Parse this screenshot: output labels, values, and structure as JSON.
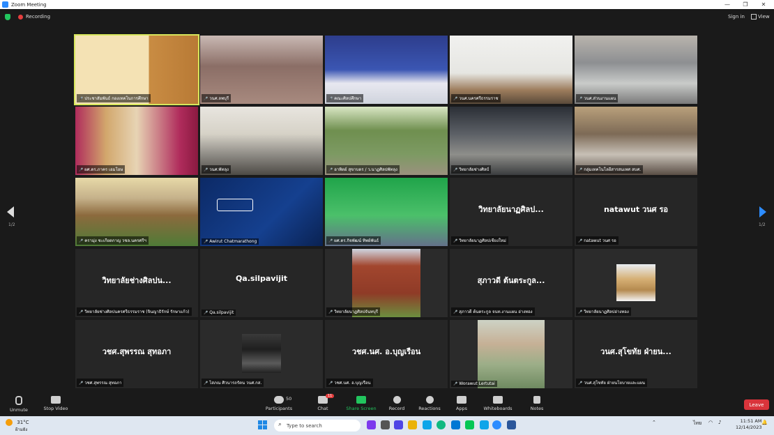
{
  "window": {
    "title": "Zoom Meeting",
    "minimize": "—",
    "restore": "❐",
    "close": "✕"
  },
  "topbar": {
    "recording": "Recording",
    "sign_in": "Sign in",
    "view": "View"
  },
  "tiles": [
    {
      "name": "ประชาสัมพันธ์ กองเทคโนการศึกษา",
      "big": "",
      "active": true,
      "scene": "room-yellow"
    },
    {
      "name": "วนศ.ลพบุรี",
      "big": "",
      "scene": "room-office"
    },
    {
      "name": "คณะศิลปศึกษา",
      "big": "",
      "scene": "room-blue"
    },
    {
      "name": "วนศ.นครศรีธรรมราช",
      "big": "",
      "scene": "room-white"
    },
    {
      "name": "วนศ.ส่วนงานแผน",
      "big": "",
      "scene": "room-lab"
    },
    {
      "name": "ผศ.ดร.ภาคร เอมโอษ",
      "big": "",
      "scene": "room-curtain"
    },
    {
      "name": "วนศ.พัทลุง",
      "big": "",
      "scene": "room-meeting"
    },
    {
      "name": "อาทิตย์ สุขาบดร / ว.นาฏศิลปพัทลุง",
      "big": "",
      "scene": "room-campus"
    },
    {
      "name": "วิทยาลัยช่างศิลป์",
      "big": "",
      "scene": "room-office2"
    },
    {
      "name": "กลุ่มเทคโนโลยีสารสนเทศ สบศ.",
      "big": "",
      "scene": "room-people"
    },
    {
      "name": "ครามุ่ง ชะเกียดกาญ วชล.นครศรีฯ",
      "big": "",
      "scene": "room-building"
    },
    {
      "name": "Awirut Chatmarathong",
      "big": "",
      "scene": "room-chula"
    },
    {
      "name": "ผศ.ดร.กิจพัฒน์ ทิพย์พันธ์",
      "big": "",
      "scene": "room-green"
    },
    {
      "name": "วิทยาลัยนาฏศิลปเชียงใหม่",
      "big": "วิทยาลัยนาฏศิลป...",
      "scene": "none"
    },
    {
      "name": "natawut วนศ รอ",
      "big": "natawut วนศ รอ",
      "scene": "none"
    },
    {
      "name": "วิทยาลัยช่างศิลปนครศรีธรรมราช (จินญาธิรักษ์ รักษาแก้ว)",
      "big": "วิทยาลัยช่างศิลปน...",
      "scene": "none"
    },
    {
      "name": "Qa.silpavijit",
      "big": "Qa.silpavijit",
      "scene": "none"
    },
    {
      "name": "วิทยาลัยนาฏศิลปจันทบุรี",
      "big": "",
      "scene": "room-photo-building"
    },
    {
      "name": "สุภาวดี ต้นตระกูล จนท.งานแผน อ่างทอง",
      "big": "สุภาวดี ต้นตระกูล...",
      "scene": "none"
    },
    {
      "name": "วิทยาลัยนาฏศิลปอ่างทอง",
      "big": "",
      "scene": "room-photo-small"
    },
    {
      "name": "วชศ.สุพรรณ สุทอภา",
      "big": "วชศ.สุพรรณ สุทอภา",
      "scene": "none"
    },
    {
      "name": "ไสภณ ศิวนารถรัตน วนศ.กส.",
      "big": "",
      "scene": "room-photo-grad"
    },
    {
      "name": "วชศ.นศ. อ.บุญเรือน",
      "big": "วชศ.นศ. อ.บุญเรือน",
      "scene": "none"
    },
    {
      "name": "Worawut Lertutai",
      "big": "",
      "scene": "room-man"
    },
    {
      "name": "วนศ.สุโขทัย ฝ่ายนโยบายและแผน",
      "big": "วนศ.สุโขทัย ฝ่ายน...",
      "scene": "none"
    }
  ],
  "pager": {
    "left": "1/2",
    "right": "1/2"
  },
  "toolbar": {
    "unmute": "Unmute",
    "stop_video": "Stop Video",
    "participants": "Participants",
    "participants_count": "50",
    "chat": "Chat",
    "chat_badge": "11",
    "share_screen": "Share Screen",
    "record": "Record",
    "reactions": "Reactions",
    "apps": "Apps",
    "whiteboards": "Whiteboards",
    "notes": "Notes",
    "leave": "Leave"
  },
  "taskbar": {
    "weather_temp": "31°C",
    "weather_desc": "ฝ้ามฝัง",
    "search_placeholder": "Type to search",
    "lang": "ไทย",
    "time": "11:51 AM",
    "date": "12/14/2023"
  }
}
